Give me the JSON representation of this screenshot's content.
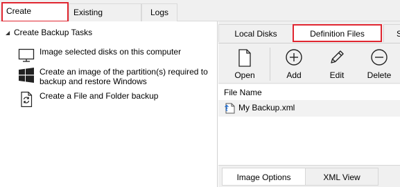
{
  "top_tabs": [
    {
      "label": "Create Backups",
      "active": true,
      "highlighted": true
    },
    {
      "label": "Existing Backups",
      "active": false
    },
    {
      "label": "Logs",
      "active": false
    }
  ],
  "tree": {
    "heading": "Create Backup Tasks",
    "items": [
      {
        "label": "Image selected disks on this computer",
        "icon": "monitor-icon"
      },
      {
        "label": "Create an image of the partition(s) required to backup and restore Windows",
        "icon": "windows-logo-icon"
      },
      {
        "label": "Create a File and Folder backup",
        "icon": "file-sync-icon"
      }
    ]
  },
  "sub_tabs": [
    {
      "label": "Local Disks",
      "active": false
    },
    {
      "label": "Definition Files",
      "active": true,
      "highlighted": true
    },
    {
      "label": "S",
      "active": false
    }
  ],
  "toolbar": {
    "open": "Open",
    "add": "Add",
    "edit": "Edit",
    "delete": "Delete"
  },
  "file_list": {
    "column_header": "File Name",
    "rows": [
      {
        "name": "My Backup.xml",
        "icon": "xml-file-icon"
      }
    ]
  },
  "bottom_tabs": [
    {
      "label": "Image Options",
      "active": true
    },
    {
      "label": "XML View",
      "active": false
    }
  ],
  "colors": {
    "highlight": "#e0252f",
    "panel_bg": "#f0f0f0",
    "accent_blue": "#1e6fd9"
  }
}
